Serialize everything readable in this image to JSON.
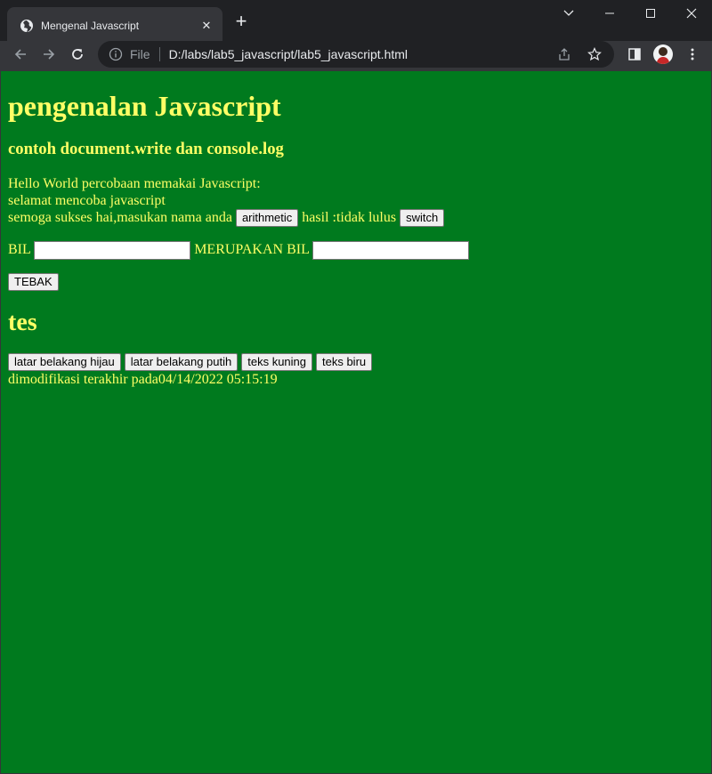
{
  "browser": {
    "tab_title": "Mengenal Javascript",
    "close_glyph": "✕",
    "newtab_glyph": "+",
    "omnibox_scheme": "File",
    "url": "D:/labs/lab5_javascript/lab5_javascript.html"
  },
  "page": {
    "heading": "pengenalan Javascript",
    "subheading": "contoh document.write dan console.log",
    "line1": "Hello World percobaan memakai Javascript:",
    "line2": "selamat mencoba javascript",
    "line3_text": "semoga sukses hai,masukan nama anda",
    "arithmetic_label": "arithmetic",
    "result_text": "hasil :tidak lulus",
    "switch_label": "switch",
    "bil_label": "BIL",
    "merupakan_label": "MERUPAKAN BIL",
    "tebak_label": "TEBAK",
    "tes_heading": "tes",
    "buttons": [
      "latar belakang hijau",
      "latar belakang putih",
      "teks kuning",
      "teks biru"
    ],
    "modified_text": "dimodifikasi terakhir pada04/14/2022 05:15:19"
  },
  "colors": {
    "page_background": "#007a1e",
    "text": "#ffff66",
    "chrome_dark": "#202124",
    "chrome": "#35363a"
  },
  "icons": {
    "favicon": "globe-icon",
    "info": "info-icon",
    "share": "share-icon",
    "star": "star-icon",
    "sidepanel": "side-panel-icon",
    "menu": "kebab-menu-icon"
  }
}
